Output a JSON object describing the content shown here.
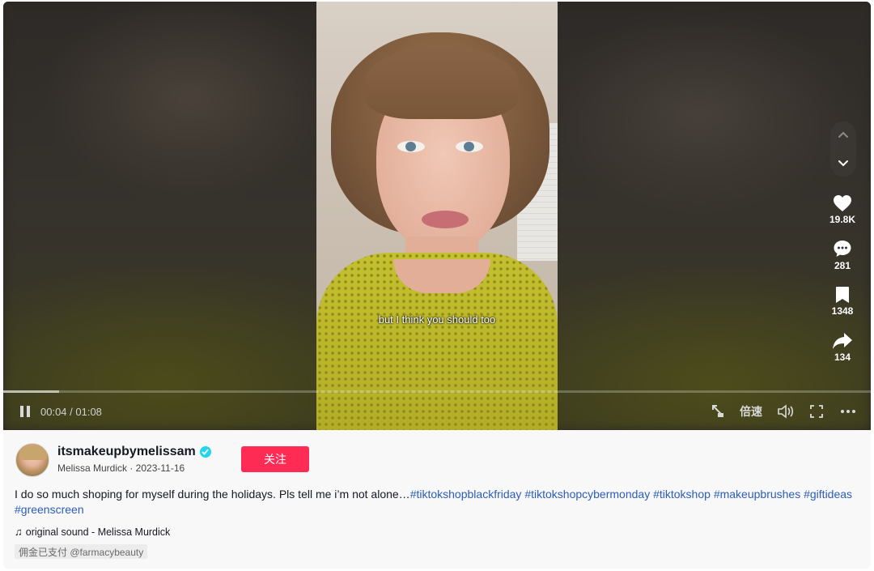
{
  "video": {
    "caption": "but I think you should too",
    "time_current": "00:04",
    "time_total": "01:08",
    "time_display": "00:04 / 01:08",
    "progress_fraction": 0.064,
    "speed_label": "倍速"
  },
  "actions": {
    "likes": "19.8K",
    "comments": "281",
    "bookmarks": "1348",
    "shares": "134"
  },
  "author": {
    "username": "itsmakeupbymelissam",
    "display_name": "Melissa Murdick",
    "date": "2023-11-16",
    "subline": "Melissa Murdick · 2023-11-16",
    "verified": true,
    "follow_label": "关注"
  },
  "description": {
    "text": "I do so much shoping for myself during the holidays. Pls tell me i’m not alone…",
    "hashtags": [
      "#tiktokshopblackfriday",
      "#tiktokshopcybermonday",
      "#tiktokshop",
      "#makeupbrushes",
      "#giftideas",
      "#greenscreen"
    ]
  },
  "music": {
    "label": "original sound - Melissa Murdick"
  },
  "sponsor": {
    "label": "佣金已支付 @farmacybeauty"
  },
  "colors": {
    "follow_button": "#fe2c55",
    "hashtag": "#2b5db9",
    "verified": "#20d5ec"
  },
  "icons": [
    "chevron-up-icon",
    "chevron-down-icon",
    "heart-icon",
    "comment-icon",
    "bookmark-icon",
    "share-icon",
    "pause-icon",
    "pip-icon",
    "volume-icon",
    "fullscreen-icon",
    "more-icon",
    "music-note-icon",
    "verified-icon"
  ]
}
